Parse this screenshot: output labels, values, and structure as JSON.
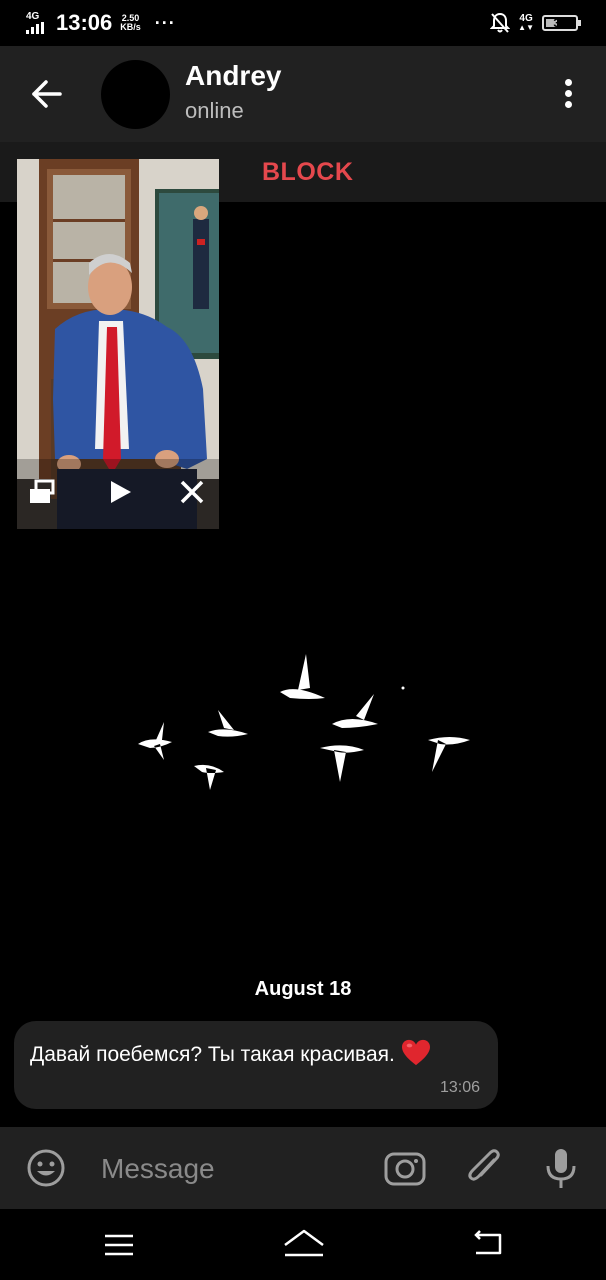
{
  "status_bar": {
    "network": "4G",
    "time": "13:06",
    "speed_value": "2.50",
    "speed_unit": "KB/s",
    "more": "···",
    "network_right": "4G",
    "battery": "34"
  },
  "header": {
    "contact_name": "Andrey",
    "contact_status": "online"
  },
  "block_bar": {
    "block_label": "BLOCK"
  },
  "chat": {
    "date_label": "August 18",
    "messages": [
      {
        "text": "Давай поебемся? Ты такая красивая.",
        "emoji": "heart-icon",
        "time": "13:06"
      }
    ]
  },
  "input_bar": {
    "placeholder": "Message"
  },
  "colors": {
    "accent_red": "#e5484d",
    "header_bg": "#212121",
    "bubble_bg": "#212121"
  }
}
